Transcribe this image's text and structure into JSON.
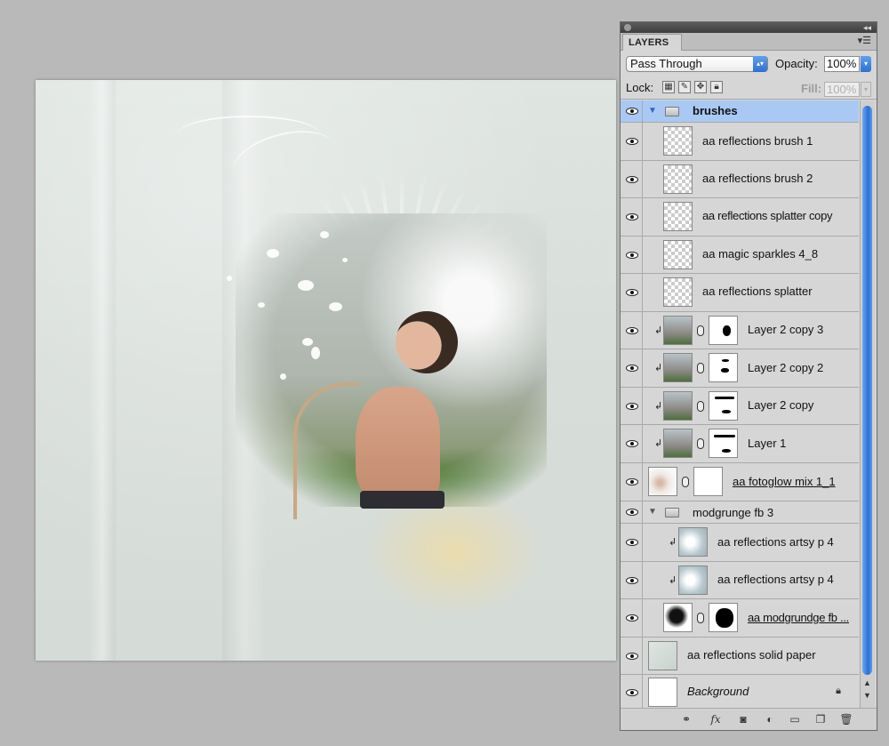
{
  "panel": {
    "tab_label": "LAYERS",
    "blend_mode": "Pass Through",
    "opacity_label": "Opacity:",
    "opacity_value": "100%",
    "lock_label": "Lock:",
    "fill_label": "Fill:",
    "fill_value": "100%"
  },
  "layers": [
    {
      "name": "brushes",
      "kind": "group",
      "selected": true
    },
    {
      "name": "aa reflections brush 1",
      "kind": "layer"
    },
    {
      "name": "aa reflections brush 2",
      "kind": "layer"
    },
    {
      "name": "aa reflections splatter copy",
      "kind": "layer"
    },
    {
      "name": "aa magic sparkles 4_8",
      "kind": "layer"
    },
    {
      "name": "aa reflections splatter",
      "kind": "layer"
    },
    {
      "name": "Layer 2 copy 3",
      "kind": "masked"
    },
    {
      "name": "Layer 2 copy 2",
      "kind": "masked"
    },
    {
      "name": "Layer 2 copy",
      "kind": "masked"
    },
    {
      "name": "Layer 1",
      "kind": "masked"
    },
    {
      "name": "aa fotoglow mix 1_1",
      "kind": "masked"
    },
    {
      "name": "modgrunge fb 3",
      "kind": "group"
    },
    {
      "name": "aa reflections artsy p 4",
      "kind": "clipped"
    },
    {
      "name": "aa reflections artsy p 4",
      "kind": "clipped"
    },
    {
      "name": "aa modgrundge fb ...",
      "kind": "masked"
    },
    {
      "name": "aa reflections solid paper",
      "kind": "layer"
    },
    {
      "name": "Background",
      "kind": "background"
    }
  ],
  "icons": {
    "visibility": "eye-icon",
    "folder": "folder-icon",
    "link": "link-icon",
    "lock": "lock-icon"
  },
  "colors": {
    "selection": "#a9c9f4",
    "scroll_accent": "#2a6fd8",
    "canvas_bg": "#b9b9b9"
  }
}
